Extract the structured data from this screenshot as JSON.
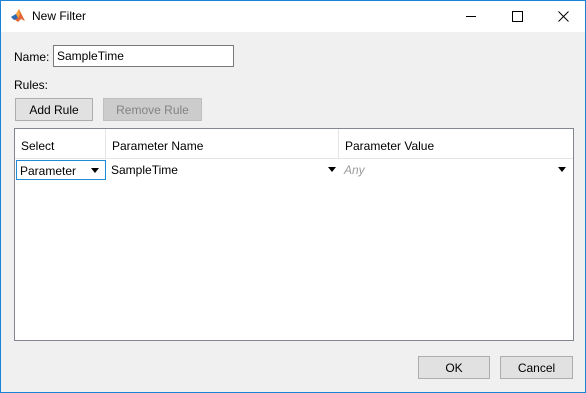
{
  "window": {
    "title": "New Filter"
  },
  "form": {
    "name_label": "Name:",
    "name_value": "SampleTime",
    "rules_label": "Rules:"
  },
  "toolbar": {
    "add_rule_label": "Add Rule",
    "remove_rule_label": "Remove Rule"
  },
  "table": {
    "columns": [
      "Select",
      "Parameter Name",
      "Parameter Value"
    ],
    "rows": [
      {
        "select": "Parameter",
        "parameter_name": "SampleTime",
        "parameter_value": "Any"
      }
    ]
  },
  "footer": {
    "ok_label": "OK",
    "cancel_label": "Cancel"
  },
  "icons": {
    "app": "matlab-icon",
    "minimize": "minimize-icon",
    "maximize": "maximize-icon",
    "close": "close-icon",
    "dropdown": "chevron-down-icon"
  },
  "colors": {
    "focus_border": "#1e8bd8",
    "window_border": "#1883d7",
    "placeholder_text": "#9c9c9c"
  }
}
